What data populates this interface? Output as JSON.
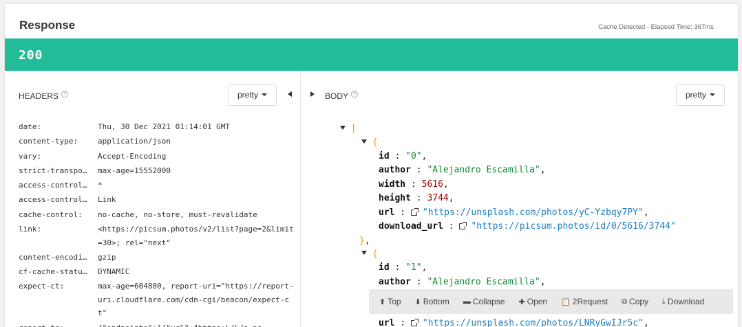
{
  "response": {
    "title": "Response",
    "meta": "Cache Detected - Elapsed Time: 367ms",
    "status": "200"
  },
  "headers_pane": {
    "label": "HEADERS",
    "format": "pretty",
    "rows": [
      {
        "key": "date:",
        "value": "Thu, 30 Dec 2021 01:14:01 GMT"
      },
      {
        "key": "content-type:",
        "value": "application/json"
      },
      {
        "key": "vary:",
        "value": "Accept-Encoding"
      },
      {
        "key": "strict-transpo…",
        "value": "max-age=15552000"
      },
      {
        "key": "access-control…",
        "value": "*"
      },
      {
        "key": "access-control…",
        "value": "Link"
      },
      {
        "key": "cache-control:",
        "value": "no-cache, no-store, must-revalidate"
      },
      {
        "key": "link:",
        "value": "<https://picsum.photos/v2/list?page=2&limit=30>; rel=\"next\""
      },
      {
        "key": "content-encodi…",
        "value": "gzip"
      },
      {
        "key": "cf-cache-statu…",
        "value": "DYNAMIC"
      },
      {
        "key": "expect-ct:",
        "value": "max-age=604800, report-uri=\"https://report-uri.cloudflare.com/cdn-cgi/beacon/expect-ct\""
      },
      {
        "key": "report-to:",
        "value": "{\"endpoints\":[{\"url\":\"https:\\/\\/a.ne"
      }
    ]
  },
  "body_pane": {
    "label": "BODY",
    "format": "pretty",
    "open_bracket": "[",
    "items": [
      {
        "id": "\"0\"",
        "author": "\"Alejandro Escamilla\"",
        "width": "5616",
        "height": "3744",
        "url": "\"https://unsplash.com/photos/yC-Yzbqy7PY\"",
        "download_url": "\"https://picsum.photos/id/0/5616/3744\""
      },
      {
        "id": "\"1\"",
        "author": "\"Alejandro Escamilla\"",
        "url": "\"https://unsplash.com/photos/LNRyGwIJr5c\""
      }
    ]
  },
  "toolbar": {
    "top": "Top",
    "bottom": "Bottom",
    "collapse": "Collapse",
    "open": "Open",
    "request": "2Request",
    "copy": "Copy",
    "download": "Download"
  },
  "colors": {
    "status_bar": "#22bc9a",
    "json_string": "#0d8a30",
    "json_number": "#a20000",
    "json_url": "#1a7ec2",
    "json_bracket": "#e8a400"
  }
}
